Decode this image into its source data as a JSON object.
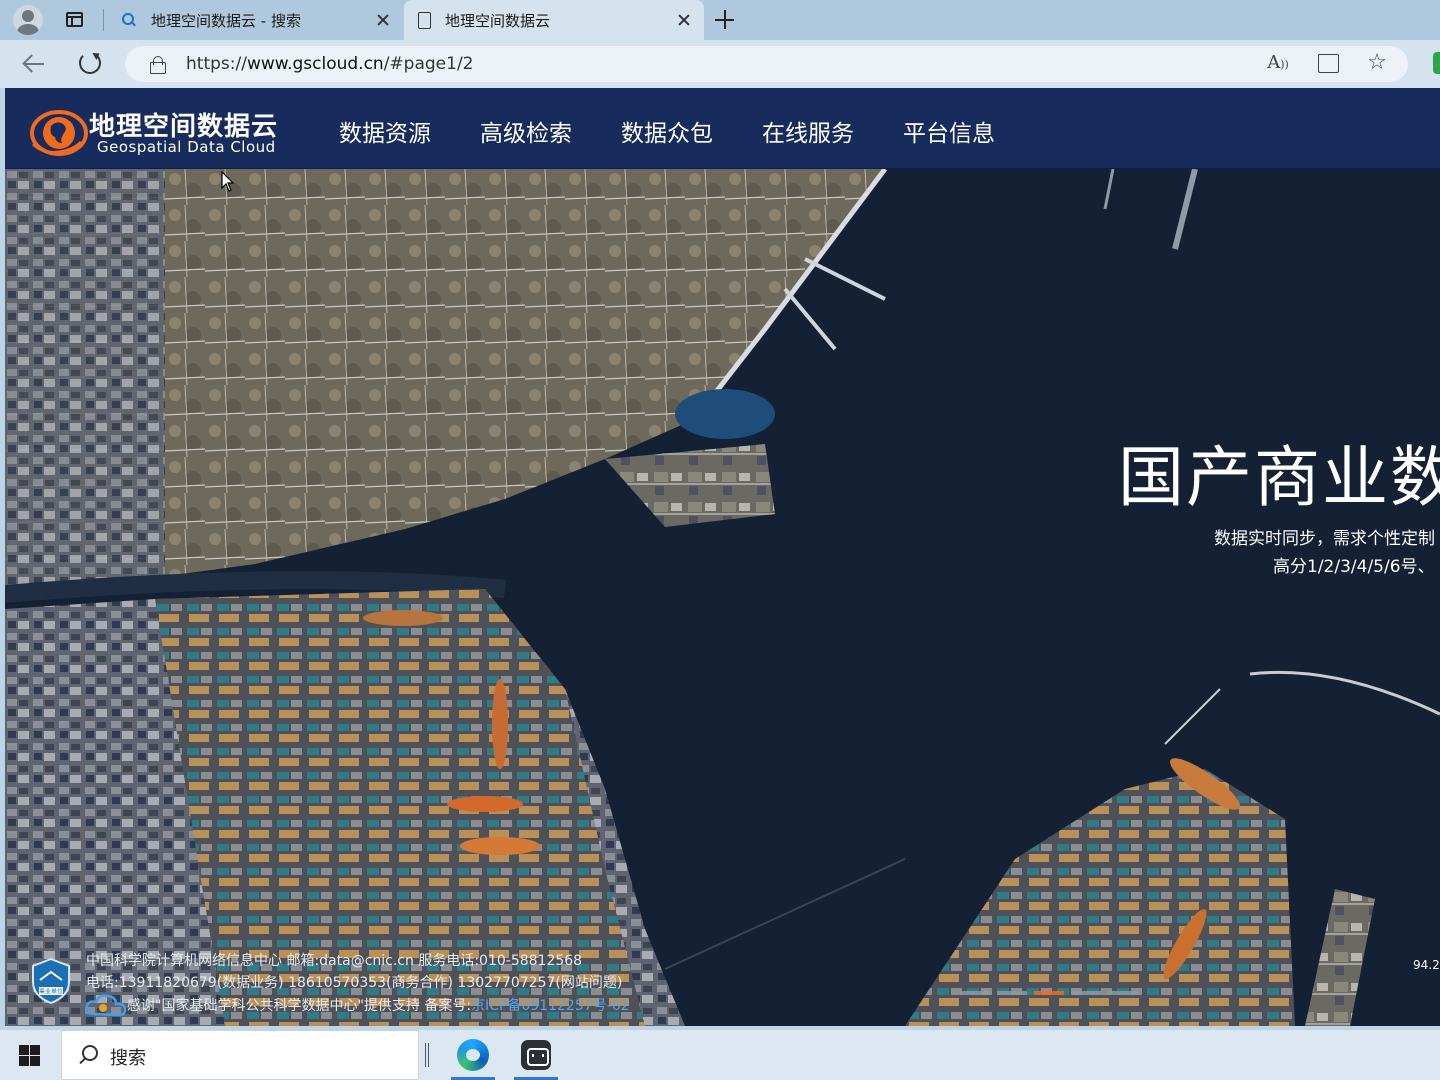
{
  "browser": {
    "tabs": [
      {
        "label": "地理空间数据云 - 搜索",
        "icon": "search-icon",
        "active": false
      },
      {
        "label": "地理空间数据云",
        "icon": "page-icon",
        "active": true
      }
    ],
    "address": {
      "prefix": "https://",
      "domain": "www.gscloud.cn",
      "path": "/#page1/2"
    },
    "read_aloud_glyph": "A̅"
  },
  "site": {
    "logo_cn": "地理空间数据云",
    "logo_en": "Geospatial Data Cloud",
    "menu": [
      "数据资源",
      "高级检索",
      "数据众包",
      "在线服务",
      "平台信息"
    ],
    "hero": {
      "title": "国产商业数据",
      "subtitle1": "数据实时同步，需求个性定制",
      "subtitle2": "高分1/2/3/4/5/6号、"
    },
    "footer": {
      "line1": "中国科学院计算机网络信息中心 邮箱:data@cnic.cn 服务电话:010-58812568",
      "line2": "电话:13911820679(数据业务) 18610570353(商务合作) 13027707257(网站问题)",
      "line3_text": "感谢\"国家基础学科公共科学数据中心\"提供支持 备案号:",
      "line3_link": "京ICP备09112257号-62",
      "badge_text": "事业单位"
    },
    "carousel": {
      "count": 5,
      "active_index": 2
    },
    "corner_number": "94.2"
  },
  "taskbar": {
    "search_placeholder": "搜索",
    "apps": [
      "edge-browser",
      "bot-app"
    ]
  },
  "colors": {
    "header_bg": "#172b5c",
    "accent_orange": "#f06a1f",
    "link_blue": "#4aa8ff",
    "sea": "#142033"
  }
}
